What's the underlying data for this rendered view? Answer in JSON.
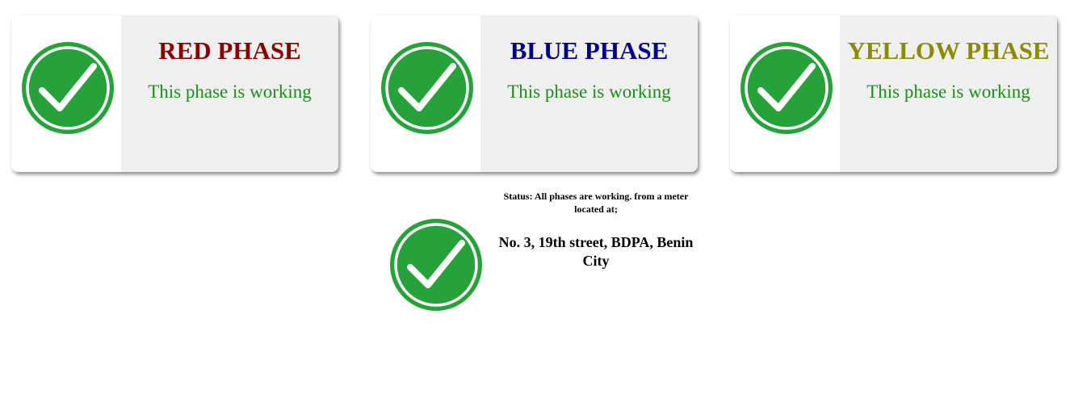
{
  "colors": {
    "check_green": "#27a23a",
    "text_green": "#1a8f1a",
    "red_phase": "#8b0000",
    "blue_phase": "#00008b",
    "yellow_phase": "#8b8b00",
    "card_background": "#efefef"
  },
  "phases": [
    {
      "title": "RED PHASE",
      "message": "This phase is working",
      "icon": "green-checkmark-icon"
    },
    {
      "title": "BLUE PHASE",
      "message": "This phase is working",
      "icon": "green-checkmark-icon"
    },
    {
      "title": "YELLOW PHASE",
      "message": "This phase is working",
      "icon": "green-checkmark-icon"
    }
  ],
  "status": {
    "text": "Status: All phases are working. from a meter located at;",
    "address": "No. 3, 19th street, BDPA, Benin City",
    "icon": "green-checkmark-icon"
  }
}
